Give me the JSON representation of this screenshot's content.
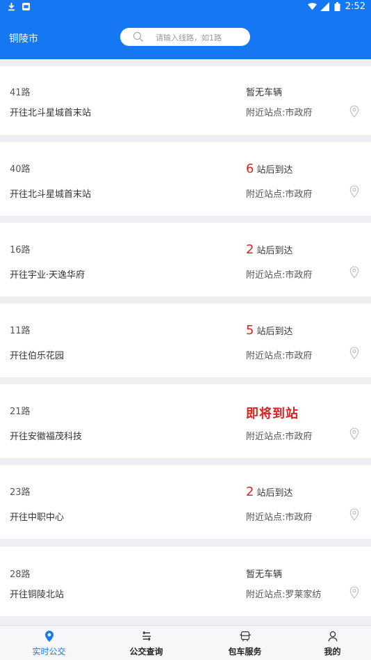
{
  "status_bar": {
    "time": "2:52",
    "icons": [
      "download-icon",
      "notification-icon",
      "wifi-icon",
      "signal-icon",
      "battery-icon"
    ]
  },
  "header": {
    "city": "铜陵市",
    "search_placeholder": "请输入线路，如1路",
    "search_icon": "search-icon"
  },
  "routes": [
    {
      "route": "41路",
      "destination": "开往北斗星城首末站",
      "arrival_num": "",
      "arrival_text": "暂无车辆",
      "nearby": "附近站点:市政府"
    },
    {
      "route": "40路",
      "destination": "开往北斗星城首末站",
      "arrival_num": "6",
      "arrival_text": "站后到达",
      "nearby": "附近站点:市政府"
    },
    {
      "route": "16路",
      "destination": "开往宇业·天逸华府",
      "arrival_num": "2",
      "arrival_text": "站后到达",
      "nearby": "附近站点:市政府"
    },
    {
      "route": "11路",
      "destination": "开往伯乐花园",
      "arrival_num": "5",
      "arrival_text": "站后到达",
      "nearby": "附近站点:市政府"
    },
    {
      "route": "21路",
      "destination": "开往安徽福茂科技",
      "arrival_num": "",
      "arrival_text": "即将到站",
      "nearby": "附近站点:市政府"
    },
    {
      "route": "23路",
      "destination": "开往中职中心",
      "arrival_num": "2",
      "arrival_text": "站后到达",
      "nearby": "附近站点:市政府"
    },
    {
      "route": "28路",
      "destination": "开往铜陵北站",
      "arrival_num": "",
      "arrival_text": "暂无车辆",
      "nearby": "附近站点:罗莱家纺"
    }
  ],
  "tabs": [
    {
      "label": "实时公交",
      "icon": "location-pin-icon",
      "active": true
    },
    {
      "label": "公交查询",
      "icon": "route-swap-icon",
      "active": false
    },
    {
      "label": "包车服务",
      "icon": "bus-icon",
      "active": false
    },
    {
      "label": "我的",
      "icon": "user-icon",
      "active": false
    }
  ],
  "colors": {
    "primary": "#1677f3",
    "alert": "#e02020",
    "background": "#eeeef3"
  }
}
